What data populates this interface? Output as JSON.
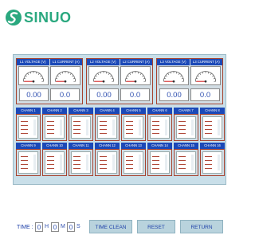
{
  "brand": {
    "name": "SINUO"
  },
  "meters": [
    {
      "voltage_label": "L1 VOLTAGE (V)",
      "current_label": "L1 CURRENT (A)",
      "voltage": "0.00",
      "current": "0.0"
    },
    {
      "voltage_label": "L2 VOLTAGE (V)",
      "current_label": "L2 CURRENT (A)",
      "voltage": "0.00",
      "current": "0.0"
    },
    {
      "voltage_label": "L3 VOLTAGE (V)",
      "current_label": "L3 CURRENT (A)",
      "voltage": "0.00",
      "current": "0.0"
    }
  ],
  "channels": [
    "CHANN 1",
    "CHANN 2",
    "CHANN 3",
    "CHANN 4",
    "CHANN 5",
    "CHANN 6",
    "CHANN 7",
    "CHANN 8",
    "CHANN 9",
    "CHANN 10",
    "CHANN 11",
    "CHANN 12",
    "CHANN 13",
    "CHANN 14",
    "CHANN 15",
    "CHANN 16"
  ],
  "timer": {
    "label": "TIME :",
    "hours": "0",
    "h_unit": "H",
    "minutes": "0",
    "m_unit": "M",
    "seconds": "0",
    "s_unit": "S"
  },
  "buttons": {
    "time_clean": "TIME CLEAN",
    "reset": "RESET",
    "return": "RETURN"
  },
  "colors": {
    "brand": "#2aa87f",
    "header_blue": "#1b49b8",
    "panel_bg": "#c9dfe9",
    "frame": "#a5432f"
  }
}
